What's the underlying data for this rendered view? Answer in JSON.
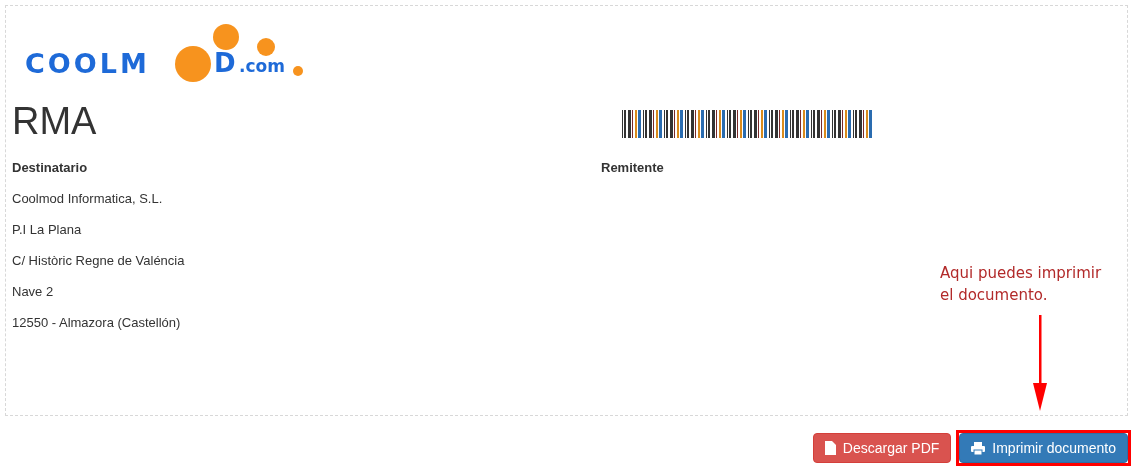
{
  "logo": {
    "left": "COOLM",
    "right": "D",
    ".com": ".com"
  },
  "title": "RMA",
  "recipient": {
    "heading": "Destinatario",
    "lines": [
      "Coolmod Informatica, S.L.",
      "P.I La Plana",
      "C/ Històric Regne de Valéncia",
      "Nave 2",
      "12550 - Almazora (Castellón)"
    ]
  },
  "sender": {
    "heading": "Remitente"
  },
  "annotation": "Aqui puedes imprimir el documento.",
  "buttons": [
    {
      "kind": "pdf",
      "label": "Descargar PDF",
      "highlighted": false
    },
    {
      "kind": "print",
      "label": "Imprimir documento",
      "highlighted": true
    }
  ]
}
